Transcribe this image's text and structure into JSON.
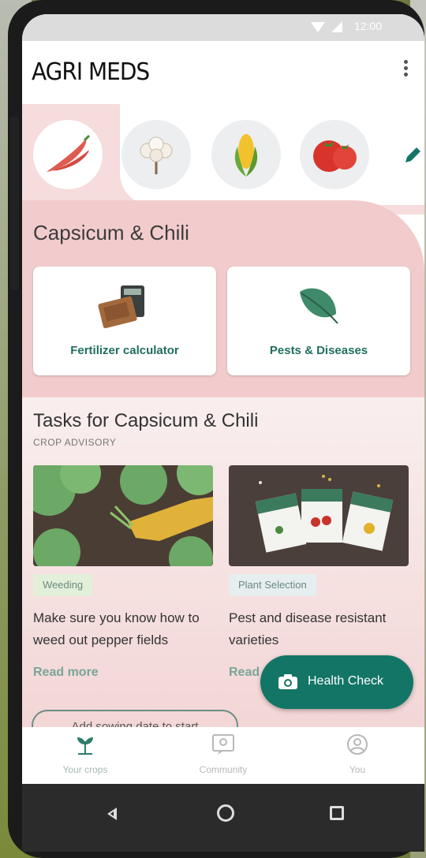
{
  "status": {
    "time": "12:00"
  },
  "app": {
    "title": "AGRI MEDS"
  },
  "crops": [
    {
      "name": "chili-pepper-icon",
      "active": true
    },
    {
      "name": "cotton-icon",
      "active": false
    },
    {
      "name": "corn-icon",
      "active": false
    },
    {
      "name": "tomato-icon",
      "active": false
    }
  ],
  "selected_crop": {
    "title": "Capsicum & Chili"
  },
  "cards": [
    {
      "label": "Fertilizer calculator",
      "icon": "calculator-icon"
    },
    {
      "label": "Pests & Diseases",
      "icon": "leaf-icon"
    }
  ],
  "tasks": {
    "title": "Tasks for Capsicum & Chili",
    "subtitle": "CROP ADVISORY",
    "items": [
      {
        "tag": "Weeding",
        "text": "Make sure you know how to weed out pepper fields",
        "link": "Read more"
      },
      {
        "tag": "Plant Selection",
        "text": "Pest and disease resistant varieties",
        "link": "Read more"
      }
    ]
  },
  "fab": {
    "label": "Health Check",
    "icon": "camera-icon"
  },
  "add_sowing": {
    "label": "Add sowing date to start"
  },
  "bottom_nav": [
    {
      "label": "Your crops",
      "icon": "plant-icon"
    },
    {
      "label": "Community",
      "icon": "chat-icon"
    },
    {
      "label": "You",
      "icon": "profile-icon"
    }
  ],
  "colors": {
    "accent": "#137566",
    "pink": "#f2cccc",
    "link": "#7aa59a"
  }
}
